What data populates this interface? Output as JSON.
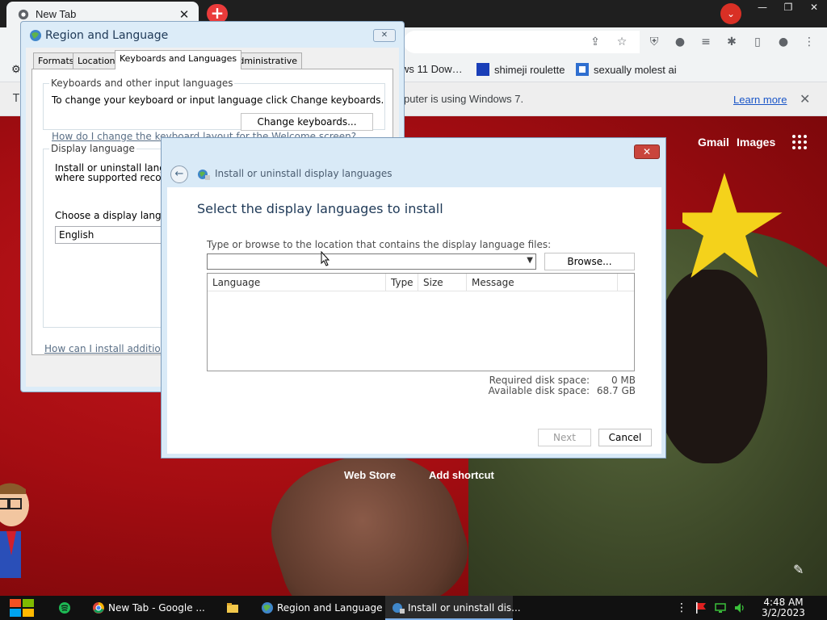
{
  "browser": {
    "tab_title": "New Tab",
    "bookmarks": [
      {
        "label": "ws 11 Dow…"
      },
      {
        "label": "shimeji roulette"
      },
      {
        "label": "sexually molest ai"
      }
    ],
    "infobar": {
      "partial_left": "T",
      "message": "puter is using Windows 7.",
      "learn_more": "Learn more"
    },
    "ntp": {
      "gmail": "Gmail",
      "images": "Images",
      "shortcuts": [
        "Web Store",
        "Add shortcut"
      ]
    }
  },
  "region_window": {
    "title": "Region and Language",
    "tabs": [
      "Formats",
      "Location",
      "Keyboards and Languages",
      "Administrative"
    ],
    "active_tab": "Keyboards and Languages",
    "keyboards_group": {
      "legend": "Keyboards and other input languages",
      "description": "To change your keyboard or input language click Change keyboards.",
      "button": "Change keyboards...",
      "link": "How do I change the keyboard layout for the Welcome screen?"
    },
    "display_group": {
      "legend": "Display language",
      "line1": "Install or uninstall langua",
      "line2": "where supported recogn",
      "choose_label": "Choose a display langua",
      "selected_language": "English",
      "install_link": "How can I install additional"
    }
  },
  "install_dialog": {
    "title": "Install or uninstall display languages",
    "heading": "Select the display languages to install",
    "prompt": "Type or browse to the location that contains the display language files:",
    "path_value": "",
    "browse_button": "Browse...",
    "columns": [
      "Language",
      "Type",
      "Size",
      "Message"
    ],
    "rows": [],
    "required_label": "Required disk space:",
    "required_value": "0 MB",
    "available_label": "Available disk space:",
    "available_value": "68.7 GB",
    "next_button": "Next",
    "cancel_button": "Cancel"
  },
  "taskbar": {
    "items": [
      {
        "label": "New Tab - Google ..."
      },
      {
        "label": "Region and Language"
      },
      {
        "label": "Install or uninstall dis..."
      }
    ],
    "clock_time": "4:48 AM",
    "clock_date": "3/2/2023"
  },
  "colors": {
    "dialog_title_text": "#1e3957",
    "link_blue": "#1a56c8",
    "close_red": "#c9453c"
  }
}
